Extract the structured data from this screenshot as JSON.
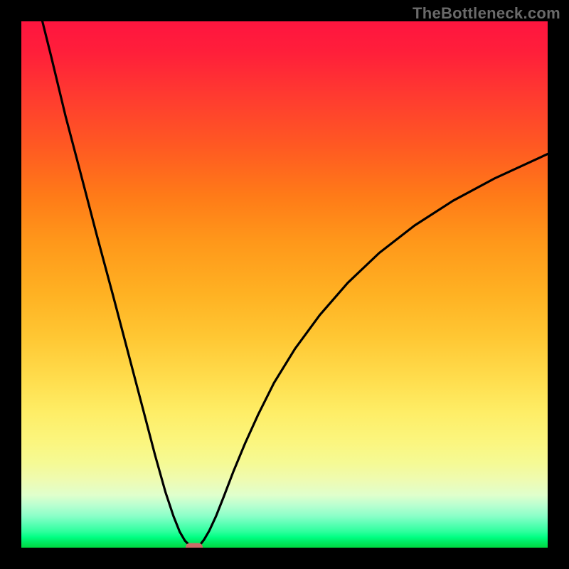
{
  "watermark": "TheBottleneck.com",
  "chart_data": {
    "type": "line",
    "title": "",
    "xlabel": "",
    "ylabel": "",
    "xlim": [
      0,
      100
    ],
    "ylim": [
      0,
      100
    ],
    "grid": false,
    "legend": false,
    "series": [
      {
        "name": "left-branch",
        "x": [
          4.0,
          5.7,
          8.4,
          11.3,
          14.3,
          17.4,
          20.3,
          23.2,
          25.4,
          27.4,
          28.9,
          30.1,
          31.1,
          31.9,
          32.4,
          32.8
        ],
        "values": [
          100.0,
          93.2,
          82.0,
          71.0,
          59.5,
          48.0,
          37.0,
          26.0,
          17.6,
          10.5,
          6.0,
          3.0,
          1.3,
          0.5,
          0.15,
          0.05
        ]
      },
      {
        "name": "right-branch",
        "x": [
          33.1,
          33.5,
          34.0,
          34.7,
          35.7,
          37.0,
          38.5,
          40.3,
          42.5,
          45.0,
          48.0,
          52.0,
          56.7,
          62.0,
          68.0,
          74.7,
          82.0,
          90.0,
          100.0
        ],
        "values": [
          0.05,
          0.2,
          0.6,
          1.5,
          3.2,
          6.0,
          9.8,
          14.5,
          19.8,
          25.3,
          31.3,
          37.8,
          44.2,
          50.3,
          56.0,
          61.2,
          65.9,
          70.2,
          74.8
        ]
      }
    ],
    "marker": {
      "x": 32.8,
      "y": 0.0,
      "color": "#cc6b67"
    }
  },
  "colors": {
    "background_frame": "#000000",
    "curve": "#000000",
    "watermark": "#6a6a6a"
  }
}
